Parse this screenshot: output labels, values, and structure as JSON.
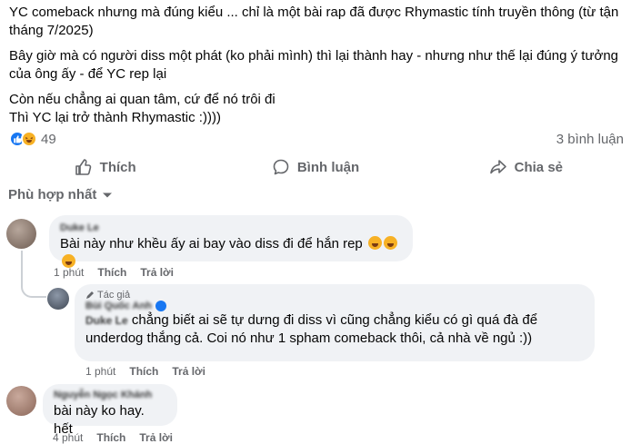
{
  "post": {
    "paragraph_1": "YC comeback nhưng mà đúng kiểu ... chỉ là một bài rap đã được Rhymastic tính truyền thông (từ tận tháng 7/2025)",
    "paragraph_2": "Bây giờ mà có người diss một phát (ko phải mình) thì lại thành hay - nhưng như thế lại đúng ý tưởng của ông ấy - để YC rep lại",
    "paragraph_3_line_1": "Còn nếu chẳng ai quan tâm, cứ để nó trôi đi",
    "paragraph_3_line_2": "Thì YC lại trở thành Rhymastic :))))"
  },
  "stats": {
    "reaction_count": "49",
    "comment_count": "3 bình luận",
    "reaction_icons": [
      "like-icon",
      "haha-icon"
    ]
  },
  "actions": {
    "like_label": "Thích",
    "comment_label": "Bình luận",
    "share_label": "Chia sẻ"
  },
  "sort": {
    "label": "Phù hợp nhất"
  },
  "comments": [
    {
      "author": "Duke Le",
      "text": "Bài này như khều ấy ai bay vào diss đi để hắn rep",
      "time": "1 phút",
      "like": "Thích",
      "reply": "Trả lời"
    },
    {
      "badge": "Tác giả",
      "author": "Bùi Quốc Anh",
      "mention": "Duke Le",
      "text": " chẳng biết ai sẽ tự dưng đi diss vì cũng chẳng kiểu có gì quá đà để underdog thắng cả. Coi nó như 1 spham comeback thôi, cả nhà về ngủ :))",
      "time": "1 phút",
      "like": "Thích",
      "reply": "Trả lời"
    },
    {
      "author": "Nguyễn Ngọc Khánh",
      "text": "bài này ko hay. hết",
      "time": "4 phút",
      "like": "Thích",
      "reply": "Trả lời"
    }
  ],
  "colors": {
    "accent": "#1877f2",
    "secondary_text": "#65676b",
    "bubble": "#f0f2f5"
  }
}
